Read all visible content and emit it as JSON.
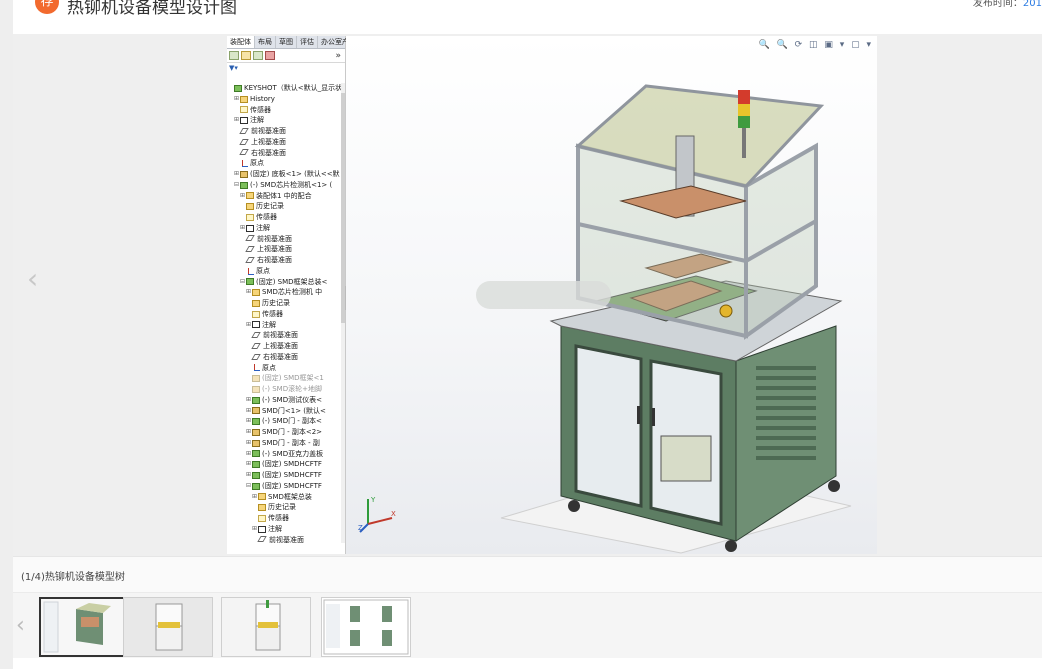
{
  "header": {
    "badge_label": "荐",
    "title": "热铆机设备模型设计图",
    "publish_label": "发布时间：",
    "publish_value": "201"
  },
  "viewer": {
    "caption": "(1/4)热铆机设备模型树",
    "prev_icon": "chevron-left-icon",
    "thumbs_count_current": 1,
    "thumbs_count_total": 4
  },
  "feature_manager": {
    "tabs": [
      "装配体",
      "布局",
      "草图",
      "评估",
      "办公室产品"
    ],
    "more_glyph": "»",
    "tree": [
      {
        "label": "KEYSHOT（默认<默认_显示状",
        "icon": "asm",
        "exp": ""
      },
      {
        "label": "History",
        "icon": "folder",
        "exp": "⊞"
      },
      {
        "label": "传感器",
        "icon": "sensor",
        "exp": ""
      },
      {
        "label": "注解",
        "icon": "note",
        "exp": "⊞"
      },
      {
        "label": "前视基准面",
        "icon": "plane",
        "exp": ""
      },
      {
        "label": "上视基准面",
        "icon": "plane",
        "exp": ""
      },
      {
        "label": "右视基准面",
        "icon": "plane",
        "exp": ""
      },
      {
        "label": "原点",
        "icon": "origin",
        "exp": ""
      },
      {
        "label": "(固定) 底板<1> (默认<<默",
        "icon": "part",
        "exp": "⊞"
      },
      {
        "label": "(-) SMD芯片检测机<1> (",
        "icon": "asm",
        "exp": "⊟"
      },
      {
        "label": "装配体1 中的配合",
        "icon": "folder",
        "exp": "⊞"
      },
      {
        "label": "历史记录",
        "icon": "folder",
        "exp": ""
      },
      {
        "label": "传感器",
        "icon": "sensor",
        "exp": ""
      },
      {
        "label": "注解",
        "icon": "note",
        "exp": "⊞"
      },
      {
        "label": "前视基准面",
        "icon": "plane",
        "exp": ""
      },
      {
        "label": "上视基准面",
        "icon": "plane",
        "exp": ""
      },
      {
        "label": "右视基准面",
        "icon": "plane",
        "exp": ""
      },
      {
        "label": "原点",
        "icon": "origin",
        "exp": ""
      },
      {
        "label": "(固定) SMD框架总装<",
        "icon": "asm",
        "exp": "⊟"
      },
      {
        "label": "SMD芯片检测机 中",
        "icon": "folder",
        "exp": "⊞"
      },
      {
        "label": "历史记录",
        "icon": "folder",
        "exp": ""
      },
      {
        "label": "传感器",
        "icon": "sensor",
        "exp": ""
      },
      {
        "label": "注解",
        "icon": "note",
        "exp": "⊞"
      },
      {
        "label": "前视基准面",
        "icon": "plane",
        "exp": ""
      },
      {
        "label": "上视基准面",
        "icon": "plane",
        "exp": ""
      },
      {
        "label": "右视基准面",
        "icon": "plane",
        "exp": ""
      },
      {
        "label": "原点",
        "icon": "origin",
        "exp": ""
      },
      {
        "label": "(固定) SMD框架<1",
        "icon": "part",
        "exp": "",
        "dim": true
      },
      {
        "label": "(-) SMD滚轮+地脚",
        "icon": "part",
        "exp": "",
        "dim": true
      },
      {
        "label": "(-) SMD测试仪表<",
        "icon": "asm",
        "exp": "⊞"
      },
      {
        "label": "SMD门<1> (默认<",
        "icon": "part",
        "exp": "⊞"
      },
      {
        "label": "(-) SMD门 - 副本<",
        "icon": "asm",
        "exp": "⊞"
      },
      {
        "label": "SMD门 - 副本<2>",
        "icon": "part",
        "exp": "⊞"
      },
      {
        "label": "SMD门 - 副本 - 副",
        "icon": "part",
        "exp": "⊞"
      },
      {
        "label": "(-) SMD亚克力盖板",
        "icon": "asm",
        "exp": "⊞"
      },
      {
        "label": "(固定) SMDHCFTF",
        "icon": "asm",
        "exp": "⊞"
      },
      {
        "label": "(固定) SMDHCFTF",
        "icon": "asm",
        "exp": "⊞"
      },
      {
        "label": "(固定) SMDHCFTF",
        "icon": "asm",
        "exp": "⊟"
      },
      {
        "label": "SMD框架总装",
        "icon": "folder",
        "exp": "⊞"
      },
      {
        "label": "历史记录",
        "icon": "folder",
        "exp": ""
      },
      {
        "label": "传感器",
        "icon": "sensor",
        "exp": ""
      },
      {
        "label": "注解",
        "icon": "note",
        "exp": "⊞"
      },
      {
        "label": "前视基准面",
        "icon": "plane",
        "exp": ""
      }
    ]
  },
  "viewport": {
    "toolbar_icons": [
      "zoom-to-fit-icon",
      "zoom-area-icon",
      "rotate-icon",
      "section-view-icon",
      "display-style-icon",
      "hide-show-icon"
    ],
    "toolbar_text": "🔍 🔍 ⟳ ◫ ▣ ▾ ▢ ▾",
    "triad_x": "X",
    "triad_y": "Y",
    "triad_z": "Z"
  },
  "colors": {
    "frame": "#b9bec6",
    "cabinet": "#5d7d63",
    "plate": "#c9906a",
    "glass": "#b8c9b2",
    "accent_orange": "#f26a2e",
    "link_blue": "#2a7ae2"
  }
}
